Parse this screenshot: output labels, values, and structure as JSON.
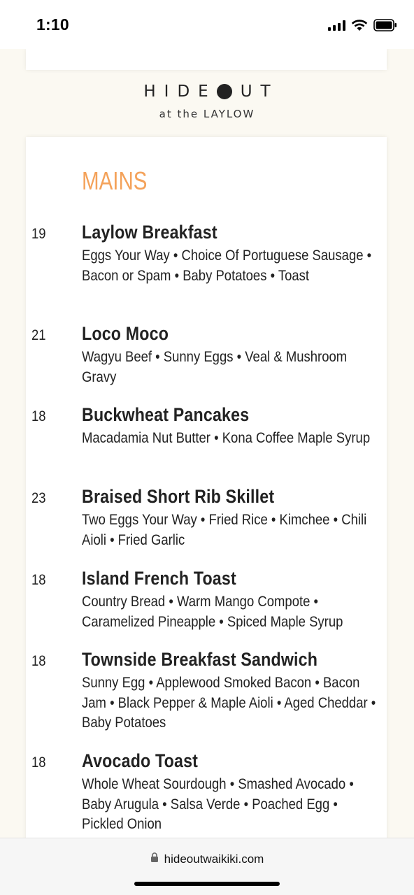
{
  "status_bar": {
    "time": "1:10"
  },
  "brand": {
    "name_part1": "HIDE",
    "name_part2": "UT",
    "subtitle": "at the LAYLOW"
  },
  "section": {
    "title": "MAINS"
  },
  "menu_items": [
    {
      "price": "19",
      "name": "Laylow Breakfast",
      "description": "Eggs Your Way • Choice Of Portuguese Sausage • Bacon or Spam • Baby Potatoes • Toast"
    },
    {
      "price": "21",
      "name": "Loco Moco",
      "description": "Wagyu Beef • Sunny Eggs • Veal & Mushroom Gravy"
    },
    {
      "price": "18",
      "name": "Buckwheat Pancakes",
      "description": "Macadamia Nut Butter • Kona Coffee Maple Syrup"
    },
    {
      "price": "23",
      "name": "Braised Short Rib Skillet",
      "description": "Two Eggs Your Way • Fried Rice • Kimchee • Chili Aioli • Fried Garlic"
    },
    {
      "price": "18",
      "name": "Island French Toast",
      "description": "Country Bread • Warm Mango Compote • Caramelized Pineapple • Spiced Maple Syrup"
    },
    {
      "price": "18",
      "name": "Townside Breakfast Sandwich",
      "description": "Sunny Egg • Applewood Smoked Bacon • Bacon Jam • Black Pepper & Maple Aioli • Aged Cheddar • Baby Potatoes"
    },
    {
      "price": "18",
      "name": "Avocado Toast",
      "description": "Whole Wheat Sourdough • Smashed Avocado • Baby Arugula • Salsa Verde • Poached Egg • Pickled Onion"
    }
  ],
  "browser": {
    "url": "hideoutwaikiki.com"
  },
  "colors": {
    "accent": "#f4a25a",
    "page_background": "#fbf9f2",
    "text": "#222222"
  },
  "icons": {
    "signal": "cellular-signal-icon",
    "wifi": "wifi-icon",
    "battery": "battery-icon",
    "lock": "lock-icon"
  }
}
